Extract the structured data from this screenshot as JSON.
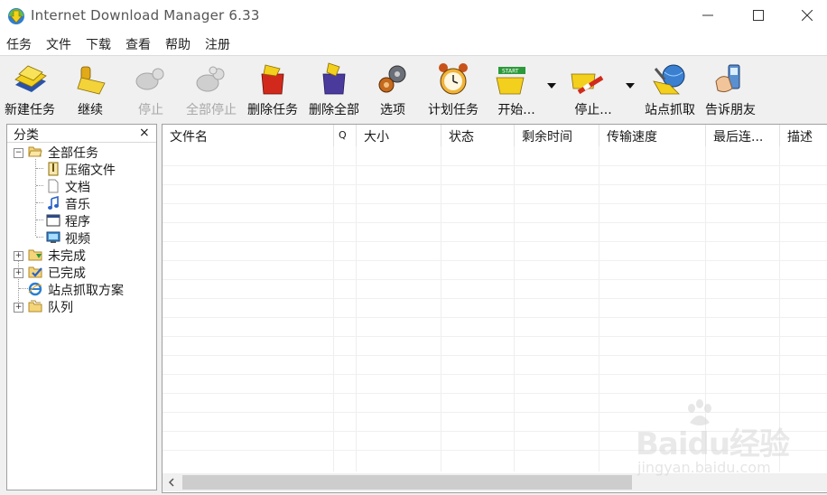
{
  "window": {
    "title": "Internet Download Manager 6.33"
  },
  "menu": [
    "任务",
    "文件",
    "下载",
    "查看",
    "帮助",
    "注册"
  ],
  "toolbar": [
    {
      "label": "新建任务",
      "icon": "new-task-icon",
      "enabled": true
    },
    {
      "label": "继续",
      "icon": "resume-icon",
      "enabled": true
    },
    {
      "label": "停止",
      "icon": "stop-icon",
      "enabled": false
    },
    {
      "label": "全部停止",
      "icon": "stop-all-icon",
      "enabled": false
    },
    {
      "label": "删除任务",
      "icon": "delete-task-icon",
      "enabled": true
    },
    {
      "label": "删除全部",
      "icon": "delete-all-icon",
      "enabled": true
    },
    {
      "label": "选项",
      "icon": "options-gear-icon",
      "enabled": true
    },
    {
      "label": "计划任务",
      "icon": "scheduler-clock-icon",
      "enabled": true
    },
    {
      "label": "开始...",
      "icon": "start-queue-icon",
      "enabled": true
    },
    {
      "label": "停止...",
      "icon": "stop-queue-icon",
      "enabled": true
    },
    {
      "label": "站点抓取",
      "icon": "site-grabber-icon",
      "enabled": true
    },
    {
      "label": "告诉朋友",
      "icon": "tell-friend-icon",
      "enabled": true
    }
  ],
  "sidebar": {
    "title": "分类",
    "close": "×",
    "items": [
      {
        "label": "全部任务",
        "icon": "folder-open-icon"
      },
      {
        "label": "压缩文件",
        "icon": "archive-file-icon"
      },
      {
        "label": "文档",
        "icon": "document-icon"
      },
      {
        "label": "音乐",
        "icon": "music-note-icon"
      },
      {
        "label": "程序",
        "icon": "program-window-icon"
      },
      {
        "label": "视频",
        "icon": "video-icon"
      },
      {
        "label": "未完成",
        "icon": "unfinished-folder-icon"
      },
      {
        "label": "已完成",
        "icon": "finished-folder-icon"
      },
      {
        "label": "站点抓取方案",
        "icon": "ie-globe-icon"
      },
      {
        "label": "队列",
        "icon": "queue-folder-icon"
      }
    ]
  },
  "columns": [
    "文件名",
    "Q",
    "大小",
    "状态",
    "剩余时间",
    "传输速度",
    "最后连...",
    "描述"
  ],
  "watermark": {
    "main": "Baidu经验",
    "sub": "jingyan.baidu.com"
  },
  "colors": {
    "accent_yellow": "#f2c51c",
    "stop_red": "#d12a1c",
    "selection_blue": "#2a62c9"
  }
}
